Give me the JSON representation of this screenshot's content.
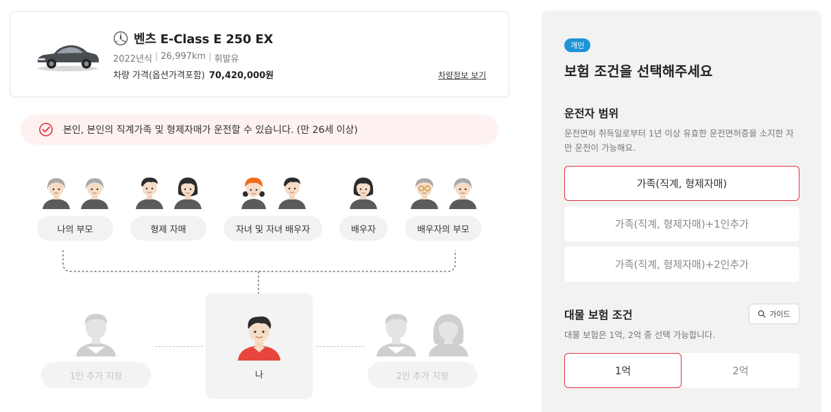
{
  "car": {
    "name": "벤츠 E-Class E 250 EX",
    "year": "2022년식",
    "mileage": "26,997km",
    "fuel": "휘발유",
    "price_label": "차량 가격(옵션가격포함)",
    "price_value": "70,420,000원",
    "detail_link": "차량정보 보기"
  },
  "notice": {
    "text": "본인, 본인의 직계가족 및 형제자매가 운전할 수 있습니다. (만 26세 이상)"
  },
  "relatives": [
    {
      "label": "나의 부모"
    },
    {
      "label": "형제 자매"
    },
    {
      "label": "자녀 및 자녀 배우자"
    },
    {
      "label": "배우자"
    },
    {
      "label": "배우자의 부모"
    }
  ],
  "persons": {
    "add_one": "1인 추가 지정",
    "me": "나",
    "add_two": "2인 추가 지정"
  },
  "panel": {
    "badge": "개인",
    "title": "보험 조건을 선택해주세요",
    "driver_section": {
      "title": "운전자 범위",
      "desc": "운전면허 취득일로부터 1년 이상 유효한 운전면허증을 소지한 자만 운전이 가능해요.",
      "options": [
        {
          "label": "가족(직계, 형제자매)",
          "selected": true
        },
        {
          "label": "가족(직계, 형제자매)+1인추가",
          "selected": false
        },
        {
          "label": "가족(직계, 형제자매)+2인추가",
          "selected": false
        }
      ]
    },
    "property_section": {
      "title": "대물 보험 조건",
      "guide_label": "가이드",
      "desc": "대물 보험은 1억, 2억 중 선택 가능합니다.",
      "options": [
        {
          "label": "1억",
          "selected": true
        },
        {
          "label": "2억",
          "selected": false
        }
      ]
    }
  },
  "colors": {
    "accent_red": "#e0313d",
    "badge_blue": "#1e95d6",
    "me_shirt": "#e8453c"
  }
}
